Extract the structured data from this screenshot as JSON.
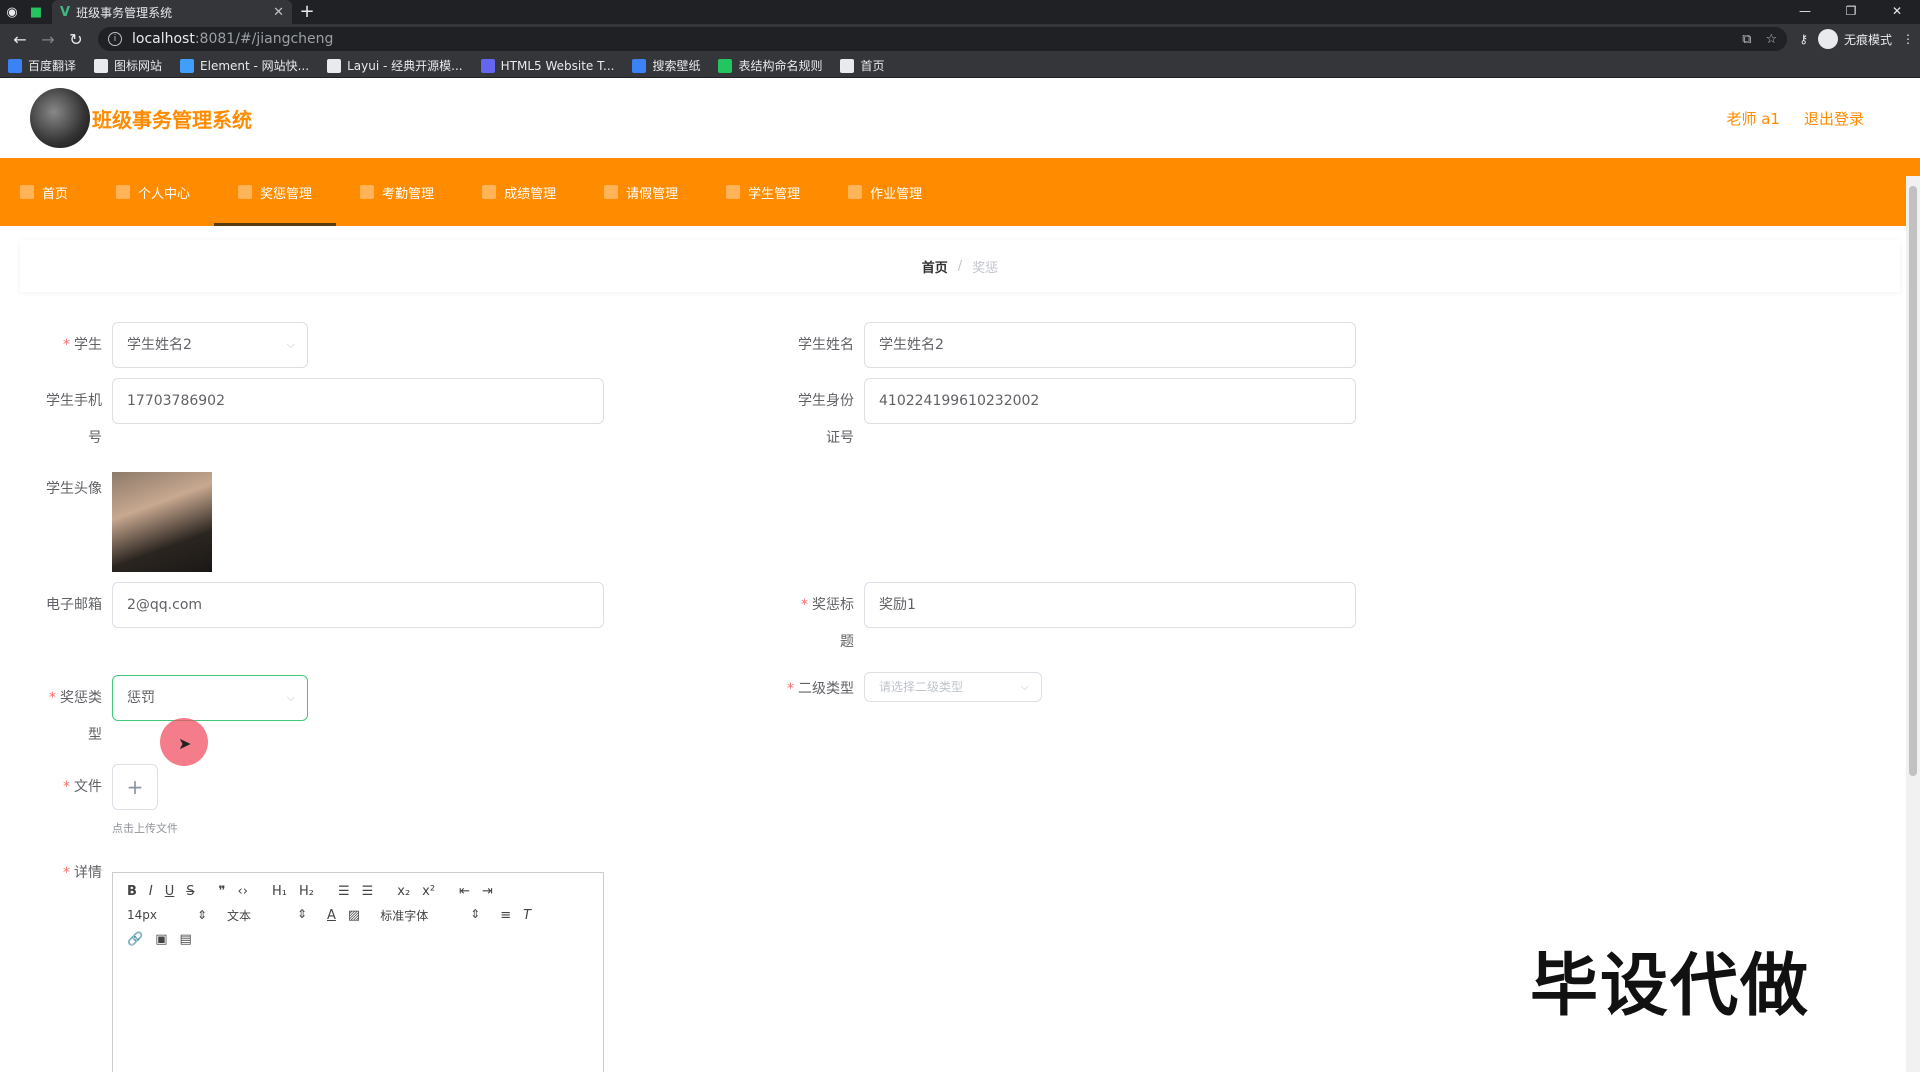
{
  "browser": {
    "tab_title": "班级事务管理系统",
    "url_host": "localhost",
    "url_path": ":8081/#/jiangcheng",
    "profile_label": "无痕模式",
    "bookmarks": [
      {
        "label": "百度翻译",
        "color": "#3b82f6"
      },
      {
        "label": "图标网站",
        "color": "#e8eaed"
      },
      {
        "label": "Element - 网站快...",
        "color": "#409eff"
      },
      {
        "label": "Layui - 经典开源模...",
        "color": "#e8eaed"
      },
      {
        "label": "HTML5 Website T...",
        "color": "#6366f1"
      },
      {
        "label": "搜索壁纸",
        "color": "#3b82f6"
      },
      {
        "label": "表结构命名规则",
        "color": "#22c55e"
      },
      {
        "label": "首页",
        "color": "#e8eaed"
      }
    ]
  },
  "header": {
    "title": "班级事务管理系统",
    "user": "老师 a1",
    "logout": "退出登录"
  },
  "menu": [
    {
      "label": "首页",
      "active": false
    },
    {
      "label": "个人中心",
      "active": false
    },
    {
      "label": "奖惩管理",
      "active": true
    },
    {
      "label": "考勤管理",
      "active": false
    },
    {
      "label": "成绩管理",
      "active": false
    },
    {
      "label": "请假管理",
      "active": false
    },
    {
      "label": "学生管理",
      "active": false
    },
    {
      "label": "作业管理",
      "active": false
    }
  ],
  "breadcrumb": {
    "home": "首页",
    "separator": "/",
    "current": "奖惩"
  },
  "form": {
    "student_label": "学生",
    "student_value": "学生姓名2",
    "student_name_label": "学生姓名",
    "student_name_value": "学生姓名2",
    "phone_label_1": "学生手机",
    "phone_label_2": "号",
    "phone_value": "17703786902",
    "idcard_label_1": "学生身份",
    "idcard_label_2": "证号",
    "idcard_value": "410224199610232002",
    "avatar_label": "学生头像",
    "email_label": "电子邮箱",
    "email_value": "2@qq.com",
    "reward_title_label_1": "奖惩标",
    "reward_title_label_2": "题",
    "reward_title_value": "奖励1",
    "reward_type_label_1": "奖惩类",
    "reward_type_label_2": "型",
    "reward_type_value": "惩罚",
    "sub_type_label": "二级类型",
    "sub_type_placeholder": "请选择二级类型",
    "file_label": "文件",
    "upload_hint": "点击上传文件",
    "detail_label": "详情",
    "required_mark": "*"
  },
  "editor": {
    "font_size": "14px",
    "header_select": "文本",
    "font_select": "标准字体"
  },
  "watermark": "毕设代做"
}
